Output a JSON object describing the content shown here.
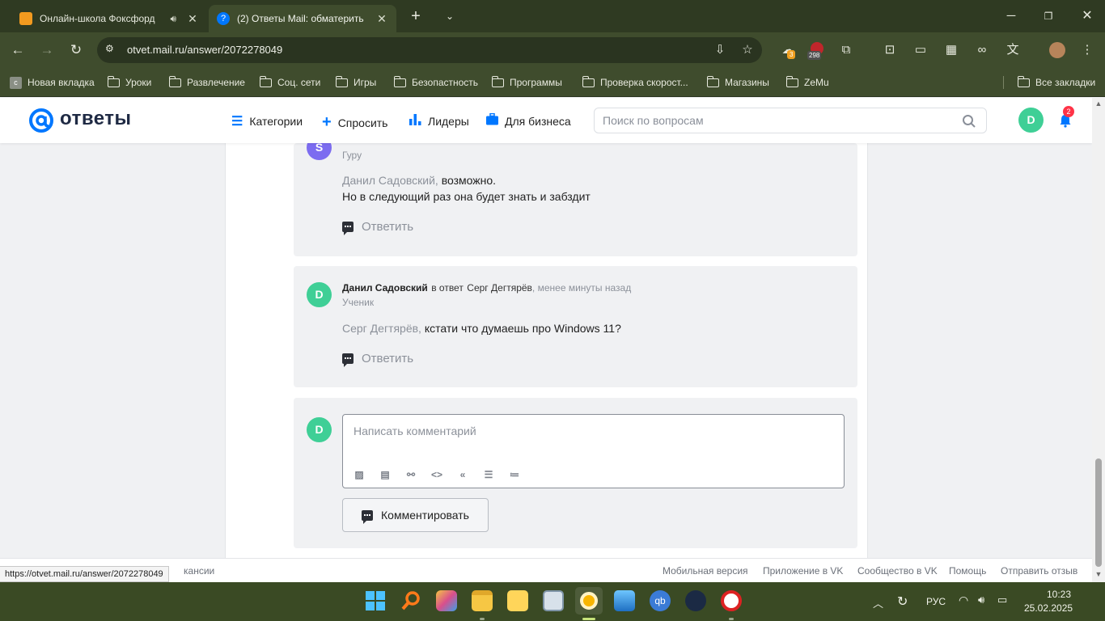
{
  "browser": {
    "tabs": [
      {
        "title": "Онлайн-школа Фоксфорд",
        "active": false
      },
      {
        "title": "(2) Ответы Mail: обматерить",
        "active": true
      }
    ],
    "url": "otvet.mail.ru/answer/2072278049",
    "extension_badges": {
      "weather": "3",
      "adblock": "298"
    },
    "bookmarks": [
      {
        "label": "Новая вкладка",
        "icon": "page-icon"
      },
      {
        "label": "Уроки",
        "icon": "folder-icon"
      },
      {
        "label": "Развлечение",
        "icon": "folder-icon"
      },
      {
        "label": "Соц. сети",
        "icon": "folder-icon"
      },
      {
        "label": "Игры",
        "icon": "folder-icon"
      },
      {
        "label": "Безопастность",
        "icon": "folder-icon"
      },
      {
        "label": "Программы",
        "icon": "folder-icon"
      },
      {
        "label": "Проверка скорост...",
        "icon": "folder-icon"
      },
      {
        "label": "Магазины",
        "icon": "folder-icon"
      },
      {
        "label": "ZeMu",
        "icon": "folder-icon"
      }
    ],
    "all_bookmarks": "Все закладки",
    "status_url": "https://otvet.mail.ru/answer/2072278049"
  },
  "site": {
    "logo_text": "ответы",
    "nav": [
      {
        "label": "Категории",
        "icon": "list-icon"
      },
      {
        "label": "Спросить",
        "icon": "plus-icon"
      },
      {
        "label": "Лидеры",
        "icon": "bar-chart-icon"
      },
      {
        "label": "Для бизнеса",
        "icon": "briefcase-icon"
      }
    ],
    "search_placeholder": "Поиск по вопросам",
    "user_initial": "D",
    "notifications_count": "2",
    "accent_color": "#0077ff"
  },
  "comments": [
    {
      "avatar_initial": "S",
      "rank": "Гуру",
      "mention": "Данил Садовский,",
      "text_line1": "возможно.",
      "text_line2": "Но в следующий раз она будет знать и забздит",
      "reply_label": "Ответить"
    },
    {
      "avatar_initial": "D",
      "author": "Данил Садовский",
      "in_reply_prefix": "в ответ",
      "in_reply_to": "Серг Дегтярёв",
      "time": ", менее минуты назад",
      "rank": "Ученик",
      "mention": "Серг Дегтярёв,",
      "text_line1": "кстати что думаешь про Windows 11?",
      "reply_label": "Ответить"
    }
  ],
  "composer": {
    "avatar_initial": "D",
    "placeholder": "Написать комментарий",
    "submit_label": "Комментировать",
    "toolbar_icons": [
      "image-icon",
      "video-icon",
      "link-icon",
      "code-icon",
      "quote-icon",
      "numbered-list-icon",
      "bullet-list-icon"
    ]
  },
  "footer": {
    "left_partial": "кансии",
    "links": [
      "Мобильная версия",
      "Приложение в VK",
      "Сообщество в VK",
      "Помощь",
      "Отправить отзыв"
    ]
  },
  "taskbar": {
    "language": "РУС",
    "time": "10:23",
    "date": "25.02.2025"
  }
}
